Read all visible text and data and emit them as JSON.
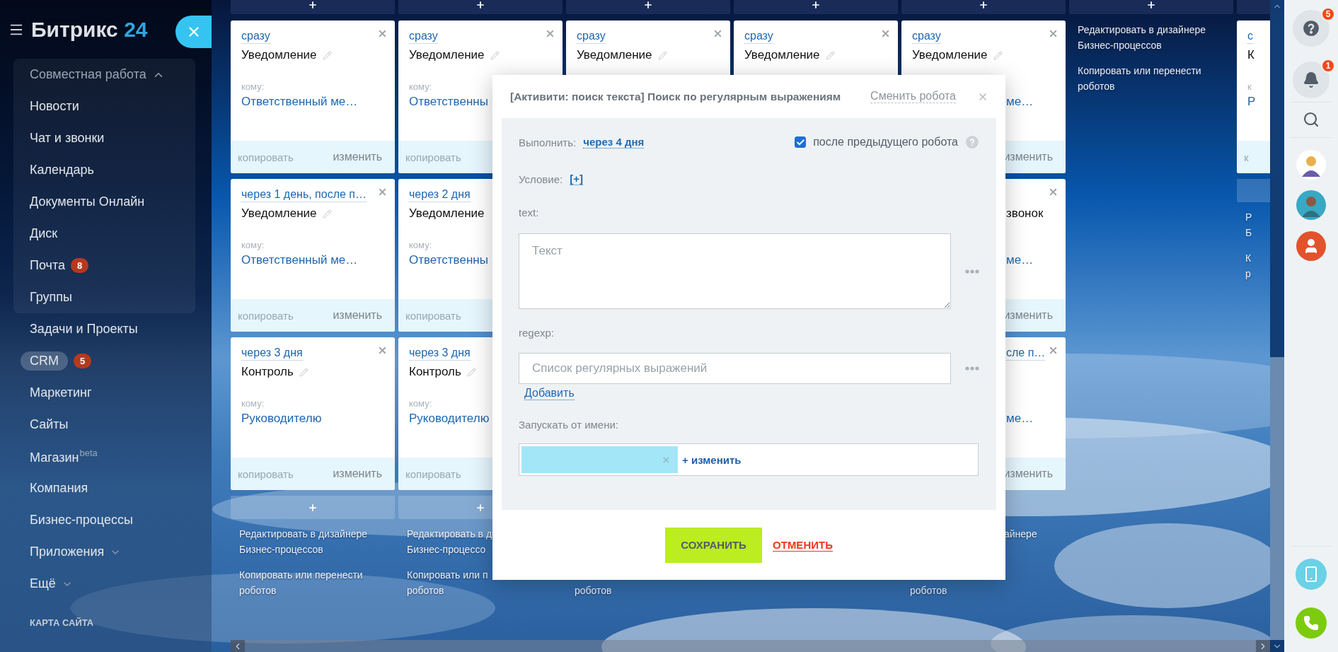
{
  "sidebar": {
    "logo": {
      "name": "Битрикс",
      "number": "24"
    },
    "items": [
      {
        "label": "Совместная работа",
        "selected": false,
        "expanded": true,
        "children": [
          {
            "label": "Новости",
            "selected": false
          },
          {
            "label": "Чат и звонки",
            "selected": false
          },
          {
            "label": "Календарь",
            "selected": false
          },
          {
            "label": "Документы Онлайн",
            "selected": false
          },
          {
            "label": "Диск",
            "selected": false
          },
          {
            "label": "Почта",
            "selected": false,
            "badge": "8"
          },
          {
            "label": "Группы",
            "selected": false
          }
        ]
      },
      {
        "label": "Задачи и Проекты",
        "selected": false
      },
      {
        "label": "CRM",
        "selected": true,
        "badge": "5"
      },
      {
        "label": "Маркетинг",
        "selected": false
      },
      {
        "label": "Сайты",
        "selected": false
      },
      {
        "label": "Магазин",
        "selected": false,
        "sup": "beta"
      },
      {
        "label": "Компания",
        "selected": false
      },
      {
        "label": "Бизнес-процессы",
        "selected": false
      },
      {
        "label": "Приложения",
        "selected": false,
        "expanded": false
      },
      {
        "label": "Ещё",
        "selected": false,
        "expanded": false
      }
    ],
    "sitemap": "КАРТА САЙТА"
  },
  "board": {
    "columns": [
      {
        "kind": "full",
        "add_top": true,
        "cards": [
          {
            "kind": "full",
            "closable": true,
            "pencil": true,
            "delay": "сразу",
            "title": "Уведомление",
            "to_label": "кому:",
            "recipient": "Ответственный ме…",
            "copy": "копировать",
            "edit": "изменить"
          },
          {
            "kind": "full",
            "closable": true,
            "pencil": true,
            "delay": "через 1 день, после п…",
            "title": "Уведомление",
            "to_label": "кому:",
            "recipient": "Ответственный ме…",
            "copy": "копировать",
            "edit": "изменить"
          },
          {
            "kind": "full",
            "closable": true,
            "pencil": true,
            "delay": "через 3 дня",
            "title": "Контроль",
            "to_label": "кому:",
            "recipient": "Руководителю",
            "copy": "копировать",
            "edit": "изменить"
          }
        ],
        "add_bottom": true,
        "links": [
          {
            "kind": "full",
            "lines": [
              "Редактировать в дизайнере",
              "Бизнес-процессов"
            ]
          },
          {
            "kind": "full",
            "lines": [
              "Копировать или перенести",
              "роботов"
            ]
          }
        ]
      },
      {
        "kind": "full",
        "add_top": true,
        "cards": [
          {
            "kind": "full",
            "closable": true,
            "pencil": true,
            "delay": "сразу",
            "title": "Уведомление",
            "to_label": "кому:",
            "recipient": "Ответственны",
            "copy": "копировать"
          },
          {
            "kind": "full",
            "closable": false,
            "pencil": false,
            "delay": "через 2 дня",
            "title": "Уведомление",
            "to_label": "кому:",
            "recipient": "Ответственны",
            "copy": "копировать"
          },
          {
            "kind": "full",
            "closable": false,
            "pencil": true,
            "delay": "через 3 дня",
            "title": "Контроль",
            "to_label": "кому:",
            "recipient": "Руководителю",
            "copy": "копировать"
          }
        ],
        "add_bottom": true,
        "links": [
          {
            "kind": "full",
            "lines": [
              "Редактировать в д",
              "Бизнес-процессо"
            ]
          },
          {
            "kind": "full",
            "lines": [
              "Копировать или п",
              "роботов"
            ]
          }
        ]
      },
      {
        "kind": "full",
        "add_top": true,
        "cards": [
          {
            "kind": "full",
            "closable": true,
            "pencil": true,
            "delay": "сразу",
            "title": "Уведомление"
          },
          {
            "kind": "hidden"
          },
          {
            "kind": "hidden"
          }
        ],
        "links": [
          {
            "kind": "hidden"
          },
          {
            "kind": "tail",
            "lines": [
              "роботов"
            ]
          }
        ]
      },
      {
        "kind": "full",
        "add_top": true,
        "cards": [
          {
            "kind": "full",
            "closable": true,
            "pencil": true,
            "delay": "сразу",
            "title": "Уведомление"
          },
          {
            "kind": "hidden"
          },
          {
            "kind": "hidden"
          }
        ]
      },
      {
        "kind": "full",
        "add_top": true,
        "cards": [
          {
            "kind": "clipped-bottom",
            "closable": true,
            "pencil": true,
            "delay": "сразу",
            "title": "Уведомление",
            "recipient": "ме…",
            "edit": "изменить"
          },
          {
            "kind": "clipped",
            "closable": true,
            "pencil": false,
            "title": "звонок",
            "recipient": "ме…",
            "edit": "изменить"
          },
          {
            "kind": "clipped",
            "closable": true,
            "pencil": false,
            "delay": "сле п…",
            "recipient": "ме…",
            "edit": "изменить"
          }
        ],
        "links": [
          {
            "kind": "clipped",
            "lines": [
              "айнере"
            ]
          },
          {
            "kind": "tail",
            "lines": [
              "роботов"
            ]
          }
        ]
      },
      {
        "kind": "full",
        "add_top": true,
        "links": [
          {
            "kind": "full",
            "lines": [
              "Редактировать в дизайнере",
              "Бизнес-процессов"
            ]
          },
          {
            "kind": "full",
            "lines": [
              "Копировать или перенести",
              "роботов"
            ]
          }
        ]
      },
      {
        "kind": "edge",
        "add_top": true,
        "cards": [
          {
            "kind": "full",
            "closable": false,
            "pencil": false,
            "delay": "с",
            "title": "К",
            "to_label": "к",
            "recipient": "Р",
            "copy": "к"
          }
        ],
        "add_bottom": true,
        "links": [
          {
            "kind": "full",
            "lines": [
              "Р",
              "Б"
            ]
          },
          {
            "kind": "full",
            "lines": [
              "К",
              "р"
            ]
          }
        ]
      }
    ]
  },
  "modal": {
    "title": "[Активити: поиск текста] Поиск по регулярным выражениям",
    "change_link": "Сменить робота",
    "execute": {
      "label": "Выполнить:",
      "value": "через 4 дня"
    },
    "after_previous": {
      "label": "после предыдущего робота",
      "checked": true
    },
    "condition": {
      "label": "Условие:",
      "value": "[+]"
    },
    "fields": [
      {
        "kind": "textarea",
        "label": "text:",
        "placeholder": "Текст"
      },
      {
        "kind": "input",
        "label": "regexp:",
        "placeholder": "Список регулярных выражений",
        "add_link": "Добавить"
      }
    ],
    "run_as": {
      "label": "Запускать от имени:",
      "change": "+ изменить"
    },
    "save": "СОХРАНИТЬ",
    "cancel": "ОТМЕНИТЬ"
  },
  "right_panel": {
    "help_badge": "5",
    "bell_badge": "1"
  }
}
